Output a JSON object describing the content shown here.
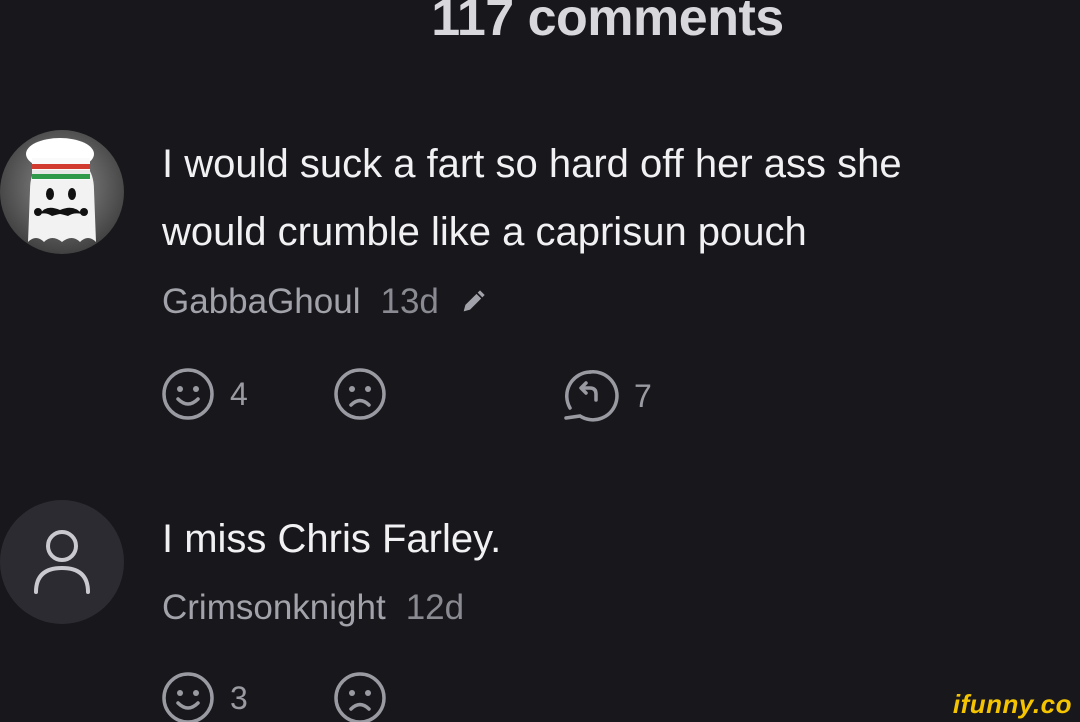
{
  "header": {
    "title": "117 comments"
  },
  "comments": [
    {
      "text": "I would suck a fart so hard off her ass she\nwould crumble like a caprisun pouch",
      "username": "GabbaGhoul",
      "age": "13d",
      "smile_count": "4",
      "frown_count": "",
      "reply_count": "7",
      "avatar": "ghost-chef-avatar"
    },
    {
      "text": "I miss Chris Farley.",
      "username": "Crimsonknight",
      "age": "12d",
      "smile_count": "3",
      "frown_count": "",
      "avatar": "default-user-avatar"
    }
  ],
  "icons": {
    "edit": "pencil-icon",
    "smile": "smile-icon",
    "frown": "frown-icon",
    "reply": "reply-icon"
  },
  "watermark": "ifunny.co",
  "colors": {
    "background": "#18181c",
    "text": "#f1f1f4",
    "muted": "#a2a2aa",
    "watermark": "#f5c400"
  }
}
